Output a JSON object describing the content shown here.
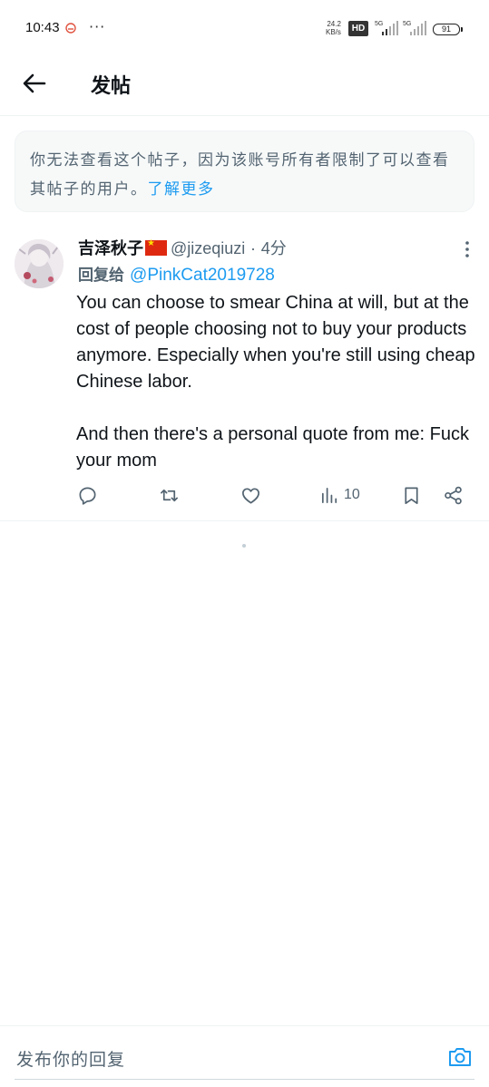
{
  "status_bar": {
    "time": "10:43",
    "more": "···",
    "speed_value": "24.2",
    "speed_unit": "KB/s",
    "hd": "HD",
    "net1": "5G",
    "net2": "5G",
    "battery": "91"
  },
  "header": {
    "title": "发帖"
  },
  "notice": {
    "text": "你无法查看这个帖子，因为该账号所有者限制了可以查看其帖子的用户。",
    "link": "了解更多"
  },
  "post": {
    "author_name": "吉泽秋子",
    "handle": "@jizeqiuzi",
    "separator": "·",
    "time": "4分",
    "reply_prefix": "回复给",
    "reply_target": "@PinkCat2019728",
    "paragraphs": [
      "You can choose to smear China at will, but at the cost of people choosing not to buy your products anymore. Especially when you're still using cheap Chinese labor.",
      "And then there's a personal quote from me: Fuck your mom"
    ],
    "views": "10"
  },
  "reply_bar": {
    "placeholder": "发布你的回复"
  },
  "colors": {
    "accent": "#1d9bf0",
    "muted": "#536471",
    "text": "#0f1419"
  },
  "icons": [
    "back-arrow-icon",
    "more-vertical-icon",
    "reply-icon",
    "repost-icon",
    "like-icon",
    "views-icon",
    "bookmark-icon",
    "share-icon",
    "camera-icon"
  ]
}
